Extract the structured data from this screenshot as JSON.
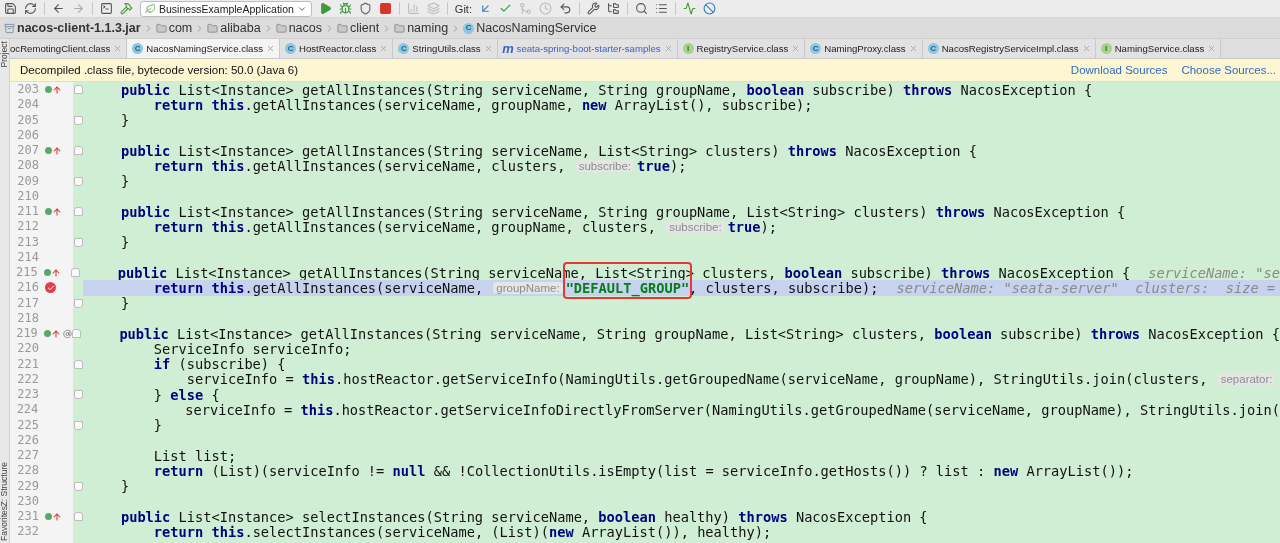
{
  "toolbar": {
    "run_config": "BusinessExampleApplication",
    "git_label": "Git:"
  },
  "breadcrumbs": [
    {
      "label": "nacos-client-1.1.3.jar",
      "kind": "jar"
    },
    {
      "label": "com",
      "kind": "folder"
    },
    {
      "label": "alibaba",
      "kind": "folder"
    },
    {
      "label": "nacos",
      "kind": "folder"
    },
    {
      "label": "client",
      "kind": "folder"
    },
    {
      "label": "naming",
      "kind": "folder"
    },
    {
      "label": "NacosNamingService",
      "kind": "class",
      "badge": "C"
    }
  ],
  "side_tools": [
    {
      "label": "Project"
    },
    {
      "label": "Z: Structure"
    },
    {
      "label": "Favorites"
    }
  ],
  "tabs": [
    {
      "label": "ocRemotingClient.class",
      "kind": "cut",
      "selected": false
    },
    {
      "label": "NacosNamingService.class",
      "kind": "class",
      "badge": "C",
      "selected": true
    },
    {
      "label": "HostReactor.class",
      "kind": "class",
      "badge": "C",
      "selected": false
    },
    {
      "label": "StringUtils.class",
      "kind": "class",
      "badge": "C",
      "selected": false
    },
    {
      "label": "seata-spring-boot-starter-samples",
      "kind": "module",
      "badge": "m",
      "selected": false
    },
    {
      "label": "RegistryService.class",
      "kind": "interface",
      "badge": "I",
      "selected": false
    },
    {
      "label": "NamingProxy.class",
      "kind": "class",
      "badge": "C",
      "selected": false
    },
    {
      "label": "NacosRegistryServiceImpl.class",
      "kind": "class",
      "badge": "C",
      "selected": false
    },
    {
      "label": "NamingService.class",
      "kind": "interface",
      "badge": "I",
      "selected": false
    }
  ],
  "banner": {
    "message": "Decompiled .class file, bytecode version: 50.0 (Java 6)",
    "links": [
      "Download Sources",
      "Choose Sources..."
    ]
  },
  "lines": [
    {
      "number": "203",
      "gutter_icons": [
        {
          "kind": "implements"
        }
      ],
      "fold": {
        "kind": "start"
      },
      "current": false,
      "tokens": [
        {
          "kind": "kw",
          "text": "    public"
        },
        {
          "kind": "code",
          "text": " List<Instance> getAllInstances(String serviceName, String groupName, "
        },
        {
          "kind": "kw",
          "text": "boolean"
        },
        {
          "kind": "code",
          "text": " subscribe) "
        },
        {
          "kind": "kw",
          "text": "throws"
        },
        {
          "kind": "code",
          "text": " NacosException {"
        }
      ]
    },
    {
      "number": "204",
      "current": false,
      "tokens": [
        {
          "kind": "kw",
          "text": "        return this"
        },
        {
          "kind": "code",
          "text": ".getAllInstances(serviceName, groupName, "
        },
        {
          "kind": "kw",
          "text": "new"
        },
        {
          "kind": "code",
          "text": " ArrayList(), subscribe);"
        }
      ]
    },
    {
      "number": "205",
      "fold": {
        "kind": "end"
      },
      "current": false,
      "tokens": [
        {
          "kind": "code",
          "text": "    }"
        }
      ]
    },
    {
      "number": "206",
      "current": false
    },
    {
      "number": "207",
      "gutter_icons": [
        {
          "kind": "implements"
        }
      ],
      "fold": {
        "kind": "start"
      },
      "current": false,
      "tokens": [
        {
          "kind": "kw",
          "text": "    public"
        },
        {
          "kind": "code",
          "text": " List<Instance> getAllInstances(String serviceName, List<String> clusters) "
        },
        {
          "kind": "kw",
          "text": "throws"
        },
        {
          "kind": "code",
          "text": " NacosException {"
        }
      ]
    },
    {
      "number": "208",
      "current": false,
      "tokens": [
        {
          "kind": "kw",
          "text": "        return this"
        },
        {
          "kind": "code",
          "text": ".getAllInstances(serviceName, clusters, "
        },
        {
          "kind": "hint",
          "text": "subscribe:"
        },
        {
          "kind": "kw",
          "text": "true"
        },
        {
          "kind": "code",
          "text": ");"
        }
      ]
    },
    {
      "number": "209",
      "fold": {
        "kind": "end"
      },
      "current": false,
      "tokens": [
        {
          "kind": "code",
          "text": "    }"
        }
      ]
    },
    {
      "number": "210",
      "current": false
    },
    {
      "number": "211",
      "gutter_icons": [
        {
          "kind": "implements"
        }
      ],
      "fold": {
        "kind": "start"
      },
      "current": false,
      "tokens": [
        {
          "kind": "kw",
          "text": "    public"
        },
        {
          "kind": "code",
          "text": " List<Instance> getAllInstances(String serviceName, String groupName, List<String> clusters) "
        },
        {
          "kind": "kw",
          "text": "throws"
        },
        {
          "kind": "code",
          "text": " NacosException {"
        }
      ]
    },
    {
      "number": "212",
      "current": false,
      "tokens": [
        {
          "kind": "kw",
          "text": "        return this"
        },
        {
          "kind": "code",
          "text": ".getAllInstances(serviceName, groupName, clusters, "
        },
        {
          "kind": "hint",
          "text": "subscribe:"
        },
        {
          "kind": "kw",
          "text": "true"
        },
        {
          "kind": "code",
          "text": ");"
        }
      ]
    },
    {
      "number": "213",
      "fold": {
        "kind": "end"
      },
      "current": false,
      "tokens": [
        {
          "kind": "code",
          "text": "    }"
        }
      ]
    },
    {
      "number": "214",
      "current": false
    },
    {
      "number": "215",
      "gutter_icons": [
        {
          "kind": "implements"
        }
      ],
      "fold": {
        "kind": "start"
      },
      "current": false,
      "tokens": [
        {
          "kind": "kw",
          "text": "    public"
        },
        {
          "kind": "code",
          "text": " List<Instance> getAllInstances(String serviceName, List<String> clusters, "
        },
        {
          "kind": "kw",
          "text": "boolean"
        },
        {
          "kind": "code",
          "text": " subscribe) "
        },
        {
          "kind": "kw",
          "text": "throws"
        },
        {
          "kind": "code",
          "text": " NacosException {"
        },
        {
          "kind": "debug",
          "text": "serviceName: \"se"
        }
      ]
    },
    {
      "number": "216",
      "gutter_icons": [
        {
          "kind": "breakpoint"
        }
      ],
      "current": true,
      "tokens": [
        {
          "kind": "kw",
          "text": "        return this"
        },
        {
          "kind": "code",
          "text": ".getAllInstances(serviceName, "
        },
        {
          "kind": "hint",
          "text": "groupName:"
        },
        {
          "kind": "str",
          "text": "\"DEFAULT_GROUP\"",
          "boxed": true
        },
        {
          "kind": "code",
          "text": ", clusters, subscribe);"
        },
        {
          "kind": "debug",
          "text": "serviceName: \"seata-server\"  clusters:  size ="
        }
      ]
    },
    {
      "number": "217",
      "fold": {
        "kind": "end"
      },
      "current": false,
      "tokens": [
        {
          "kind": "code",
          "text": "    }"
        }
      ]
    },
    {
      "number": "218",
      "current": false
    },
    {
      "number": "219",
      "gutter_icons": [
        {
          "kind": "implements"
        },
        {
          "kind": "annotation"
        }
      ],
      "fold": {
        "kind": "start"
      },
      "current": false,
      "tokens": [
        {
          "kind": "kw",
          "text": "    public"
        },
        {
          "kind": "code",
          "text": " List<Instance> getAllInstances(String serviceName, String groupName, List<String> clusters, "
        },
        {
          "kind": "kw",
          "text": "boolean"
        },
        {
          "kind": "code",
          "text": " subscribe) "
        },
        {
          "kind": "kw",
          "text": "throws"
        },
        {
          "kind": "code",
          "text": " NacosException {"
        }
      ]
    },
    {
      "number": "220",
      "current": false,
      "tokens": [
        {
          "kind": "code",
          "text": "        ServiceInfo serviceInfo;"
        }
      ]
    },
    {
      "number": "221",
      "fold": {
        "kind": "start"
      },
      "current": false,
      "tokens": [
        {
          "kind": "kw",
          "text": "        if"
        },
        {
          "kind": "code",
          "text": " (subscribe) {"
        }
      ]
    },
    {
      "number": "222",
      "current": false,
      "tokens": [
        {
          "kind": "code",
          "text": "            serviceInfo = "
        },
        {
          "kind": "kw",
          "text": "this"
        },
        {
          "kind": "code",
          "text": ".hostReactor.getServiceInfo(NamingUtils.getGroupedName(serviceName, groupName), StringUtils.join(clusters, "
        },
        {
          "kind": "hint",
          "text": "separator:"
        }
      ]
    },
    {
      "number": "223",
      "fold": {
        "kind": "end"
      },
      "current": false,
      "tokens": [
        {
          "kind": "code",
          "text": "        } "
        },
        {
          "kind": "kw",
          "text": "else"
        },
        {
          "kind": "code",
          "text": " {"
        }
      ]
    },
    {
      "number": "224",
      "current": false,
      "tokens": [
        {
          "kind": "code",
          "text": "            serviceInfo = "
        },
        {
          "kind": "kw",
          "text": "this"
        },
        {
          "kind": "code",
          "text": ".hostReactor.getServiceInfoDirectlyFromServer(NamingUtils.getGroupedName(serviceName, groupName), StringUtils.join("
        }
      ]
    },
    {
      "number": "225",
      "fold": {
        "kind": "end"
      },
      "current": false,
      "tokens": [
        {
          "kind": "code",
          "text": "        }"
        }
      ]
    },
    {
      "number": "226",
      "current": false
    },
    {
      "number": "227",
      "current": false,
      "tokens": [
        {
          "kind": "code",
          "text": "        List list;"
        }
      ]
    },
    {
      "number": "228",
      "current": false,
      "tokens": [
        {
          "kind": "kw",
          "text": "        return"
        },
        {
          "kind": "code",
          "text": " (List)(serviceInfo != "
        },
        {
          "kind": "kw",
          "text": "null"
        },
        {
          "kind": "code",
          "text": " && !CollectionUtils.isEmpty(list = serviceInfo.getHosts()) ? list : "
        },
        {
          "kind": "kw",
          "text": "new"
        },
        {
          "kind": "code",
          "text": " ArrayList());"
        }
      ]
    },
    {
      "number": "229",
      "fold": {
        "kind": "end"
      },
      "current": false,
      "tokens": [
        {
          "kind": "code",
          "text": "    }"
        }
      ]
    },
    {
      "number": "230",
      "current": false
    },
    {
      "number": "231",
      "gutter_icons": [
        {
          "kind": "implements"
        }
      ],
      "fold": {
        "kind": "start"
      },
      "current": false,
      "tokens": [
        {
          "kind": "kw",
          "text": "    public"
        },
        {
          "kind": "code",
          "text": " List<Instance> selectInstances(String serviceName, "
        },
        {
          "kind": "kw",
          "text": "boolean"
        },
        {
          "kind": "code",
          "text": " healthy) "
        },
        {
          "kind": "kw",
          "text": "throws"
        },
        {
          "kind": "code",
          "text": " NacosException {"
        }
      ]
    },
    {
      "number": "232",
      "current": false,
      "tokens": [
        {
          "kind": "kw",
          "text": "        return this"
        },
        {
          "kind": "code",
          "text": ".selectInstances(serviceName, (List)("
        },
        {
          "kind": "kw",
          "text": "new"
        },
        {
          "kind": "code",
          "text": " ArrayList()), healthy);"
        }
      ]
    }
  ]
}
